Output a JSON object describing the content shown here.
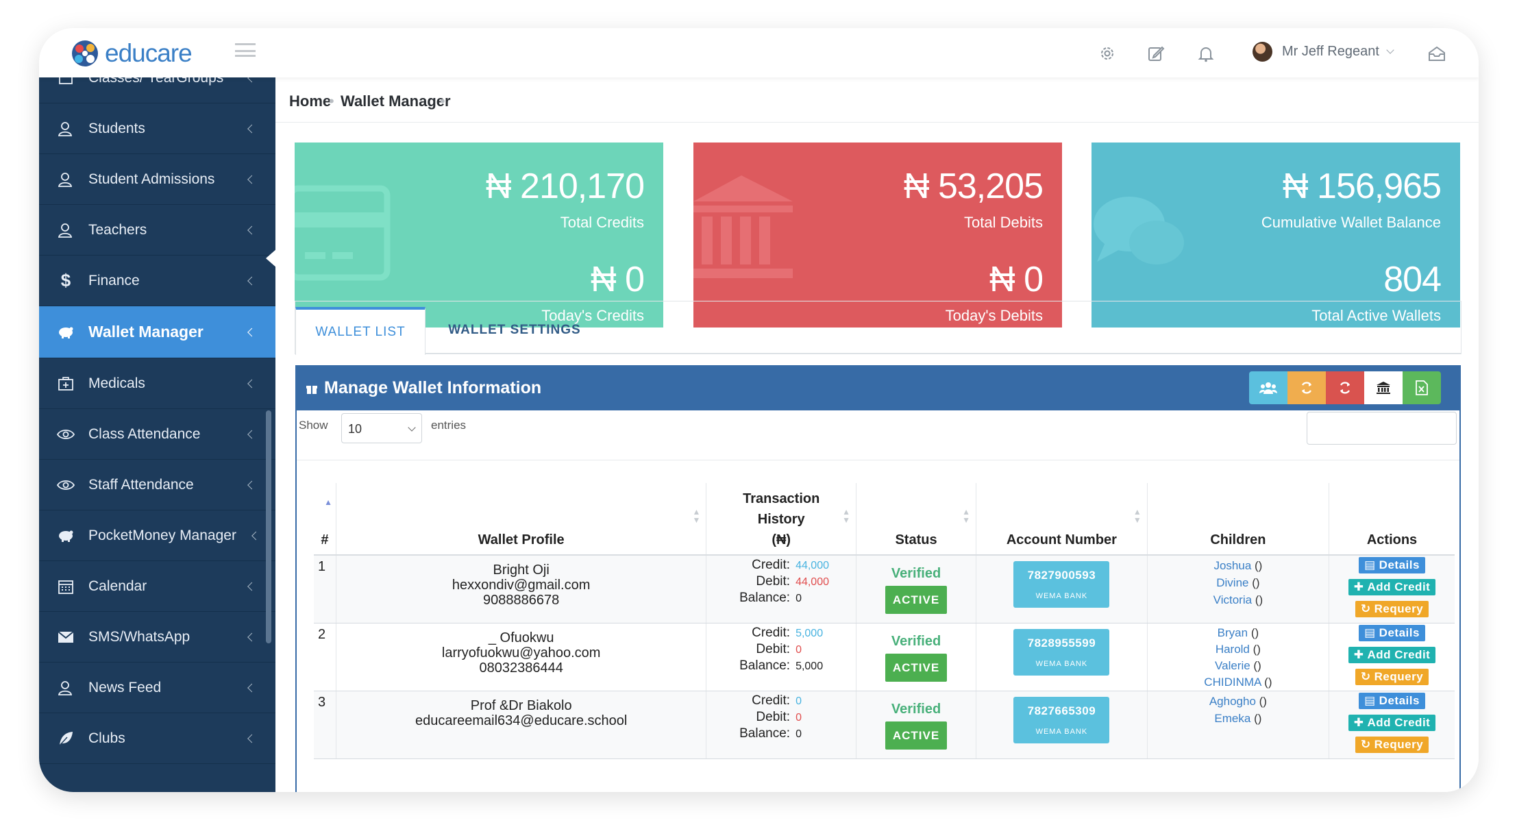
{
  "app": {
    "logo_text": "educare"
  },
  "topbar": {
    "user_name": "Mr Jeff Regeant"
  },
  "sidebar": {
    "items": [
      {
        "label": "Classes/ YearGroups",
        "icon": "class-icon"
      },
      {
        "label": "Students",
        "icon": "user-icon"
      },
      {
        "label": "Student Admissions",
        "icon": "user-icon"
      },
      {
        "label": "Teachers",
        "icon": "user-icon"
      },
      {
        "label": "Finance",
        "icon": "dollar-icon"
      },
      {
        "label": "Wallet Manager",
        "icon": "piggy-bank-icon"
      },
      {
        "label": "Medicals",
        "icon": "medical-kit-icon"
      },
      {
        "label": "Class Attendance",
        "icon": "eye-icon"
      },
      {
        "label": "Staff Attendance",
        "icon": "eye-icon"
      },
      {
        "label": "PocketMoney Manager",
        "icon": "piggy-bank-icon"
      },
      {
        "label": "Calendar",
        "icon": "calendar-icon"
      },
      {
        "label": "SMS/WhatsApp",
        "icon": "envelope-icon"
      },
      {
        "label": "News Feed",
        "icon": "user-icon"
      },
      {
        "label": "Clubs",
        "icon": "leaf-icon"
      }
    ]
  },
  "breadcrumb": {
    "home": "Home",
    "current": "Wallet Manager"
  },
  "stats": {
    "credits": {
      "total": "₦ 210,170",
      "total_label": "Total Credits",
      "today": "₦ 0",
      "today_label": "Today's Credits",
      "color": "#6dd5b9"
    },
    "debits": {
      "total": "₦ 53,205",
      "total_label": "Total Debits",
      "today": "₦ 0",
      "today_label": "Today's Debits",
      "color": "#dd5a5e"
    },
    "wallet": {
      "total": "₦ 156,965",
      "total_label": "Cumulative Wallet Balance",
      "today": "804",
      "today_label": "Total Active Wallets",
      "color": "#5bbecf"
    }
  },
  "tabs": {
    "list": "WALLET LIST",
    "settings": "WALLET SETTINGS"
  },
  "panel": {
    "title": "Manage Wallet Information",
    "show_label": "Show",
    "page_size": "10",
    "entries_label": "entries",
    "toolbar_colors": [
      "#5bc0de",
      "#f0ad4e",
      "#d9534f",
      "#ffffff",
      "#5cb85c"
    ]
  },
  "table": {
    "headers": [
      "#",
      "Wallet Profile",
      "Transaction History (₦)",
      "Status",
      "Account Number",
      "Children",
      "Actions"
    ],
    "header_txn_lines": [
      "Transaction",
      "History",
      "(₦)"
    ],
    "credit_label": "Credit:",
    "debit_label": "Debit:",
    "balance_label": "Balance:",
    "verified_label": "Verified",
    "active_label": "ACTIVE",
    "bank_label": "WEMA BANK",
    "btn_details": "Details",
    "btn_add_credit": "Add Credit",
    "btn_requery": "Requery",
    "rows": [
      {
        "num": "1",
        "name": "Bright Oji",
        "email": "hexxondiv@gmail.com",
        "phone": "9088886678",
        "credit": "44,000",
        "debit": "44,000",
        "balance": "0",
        "account": "7827900593",
        "children": [
          "Joshua",
          "Divine",
          "Victoria"
        ]
      },
      {
        "num": "2",
        "name": "_ Ofuokwu",
        "email": "larryofuokwu@yahoo.com",
        "phone": "08032386444",
        "credit": "5,000",
        "debit": "0",
        "balance": "5,000",
        "account": "7828955599",
        "children": [
          "Bryan",
          "Harold",
          "Valerie",
          "CHIDINMA"
        ]
      },
      {
        "num": "3",
        "name": "Prof &Dr Biakolo",
        "email": "educareemail634@educare.school",
        "phone": "",
        "credit": "0",
        "debit": "0",
        "balance": "0",
        "account": "7827665309",
        "children": [
          "Aghogho",
          "Emeka"
        ]
      }
    ]
  }
}
